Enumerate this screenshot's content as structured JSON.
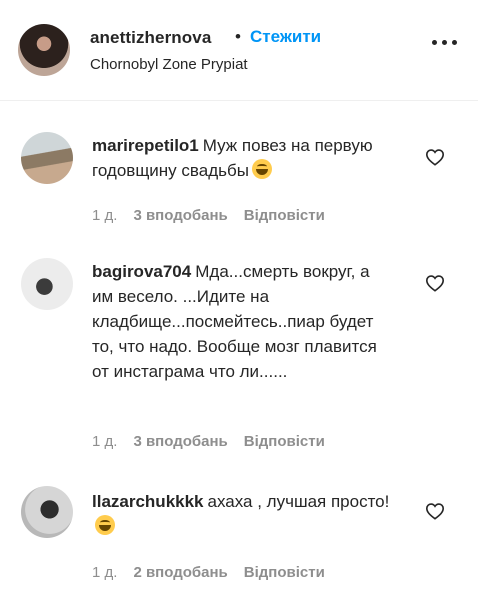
{
  "post": {
    "username": "anettizhernova",
    "separator": "•",
    "follow_label": "Стежити",
    "location": "Chornobyl Zone Prypiat"
  },
  "comments": [
    {
      "username": "marirepetilo1",
      "text": "Муж повез на первую годовщину свадьбы",
      "emoji": "laughing-face",
      "time": "1 д.",
      "likes": "3 вподобань",
      "reply_label": "Відповісти"
    },
    {
      "username": "bagirova704",
      "text": "Мда...смерть вокруг, а им весело. ...Идите на кладбище...посмейтесь..пиар будет то, что надо. Вообще мозг плавится от инстаграма что ли......",
      "time": "1 д.",
      "likes": "3 вподобань",
      "reply_label": "Відповісти"
    },
    {
      "username": "llazarchukkkk",
      "text": "ахаха , лучшая просто!",
      "emoji": "laughing-face",
      "time": "1 д.",
      "likes": "2 вподобань",
      "reply_label": "Відповісти"
    }
  ],
  "icons": {
    "more": "more-options-icon",
    "like": "heart-icon"
  },
  "colors": {
    "follow": "#0095f6",
    "text": "#262626",
    "meta": "#8e8e8e"
  }
}
